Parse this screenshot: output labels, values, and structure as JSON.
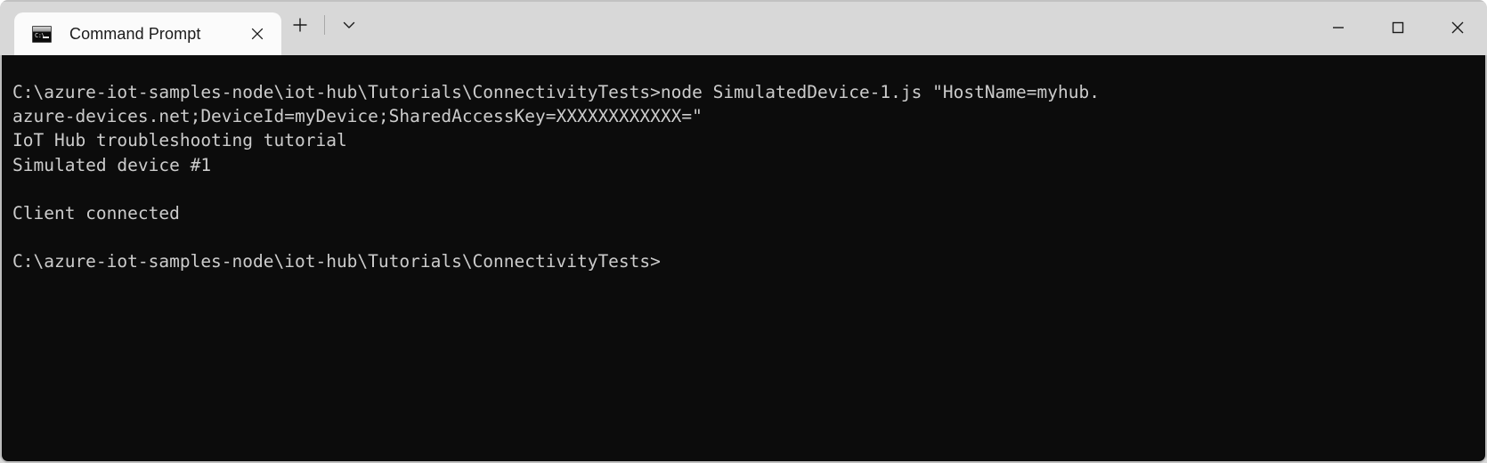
{
  "window": {
    "tab": {
      "title": "Command Prompt",
      "icon_name": "console-icon",
      "icon_prompt_text": "C:\\",
      "close_icon": "close-icon"
    },
    "new_tab_label": "+",
    "dropdown_label": "⌄",
    "controls": {
      "minimize": "Minimize",
      "maximize": "Maximize",
      "close": "Close"
    },
    "colors": {
      "titlebar_bg": "#d8d8d8",
      "tab_bg": "#fbfbfb",
      "terminal_bg": "#0c0c0c",
      "terminal_fg": "#cccccc",
      "window_border": "#bdbdbd"
    }
  },
  "terminal": {
    "lines": [
      "C:\\azure-iot-samples-node\\iot-hub\\Tutorials\\ConnectivityTests>node SimulatedDevice-1.js \"HostName=myhub.",
      "azure-devices.net;DeviceId=myDevice;SharedAccessKey=XXXXXXXXXXXX=\"",
      "IoT Hub troubleshooting tutorial",
      "Simulated device #1",
      "",
      "Client connected",
      "",
      "C:\\azure-iot-samples-node\\iot-hub\\Tutorials\\ConnectivityTests>"
    ],
    "text": "C:\\azure-iot-samples-node\\iot-hub\\Tutorials\\ConnectivityTests>node SimulatedDevice-1.js \"HostName=myhub.\nazure-devices.net;DeviceId=myDevice;SharedAccessKey=XXXXXXXXXXXX=\"\nIoT Hub troubleshooting tutorial\nSimulated device #1\n\nClient connected\n\nC:\\azure-iot-samples-node\\iot-hub\\Tutorials\\ConnectivityTests>"
  }
}
